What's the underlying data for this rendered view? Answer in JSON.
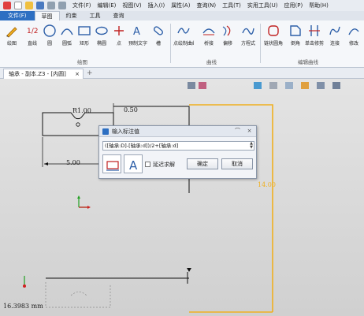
{
  "menu": [
    "文件(F)",
    "编辑(E)",
    "视图(V)",
    "插入(I)",
    "属性(A)",
    "查询(N)",
    "工具(T)",
    "实用工具(U)",
    "应用(P)",
    "帮助(H)"
  ],
  "ribbon_tabs": [
    "文件(F)",
    "草图",
    "约束",
    "工具",
    "查询"
  ],
  "tools": {
    "draw": "绘图",
    "line": "直线",
    "circle": "圆",
    "arc": "圆弧",
    "rect": "矩形",
    "ellipse": "椭圆",
    "point": "点",
    "text": "预制文字",
    "slot": "槽",
    "curve_point": "点绘制曲线",
    "bridge": "桥接",
    "offset": "偏移",
    "equation": "方程式",
    "chain_fillet": "链状圆角",
    "chamfer": "倒角",
    "trim": "单击修剪",
    "connect": "连接",
    "modify": "修改"
  },
  "groups": {
    "draw": "绘图",
    "curve": "曲线",
    "edit": "编辑曲线"
  },
  "doc_tab": "轴承 - 副本.Z3 - [内圆]",
  "dims": {
    "r1": "R1.00",
    "d050": "0.50",
    "d500": "5.00",
    "d1400": "14.00"
  },
  "status_value": "16.3983 mm",
  "dialog": {
    "title": "输入标注值",
    "expression": "([轴承:D]-[轴承:d])/2+[轴承:d]",
    "defer_label": "延迟求解",
    "ok": "确定",
    "cancel": "取消"
  },
  "colors": {
    "file_tab": "#2d6fc2",
    "dim_highlight": "#f0b020"
  }
}
